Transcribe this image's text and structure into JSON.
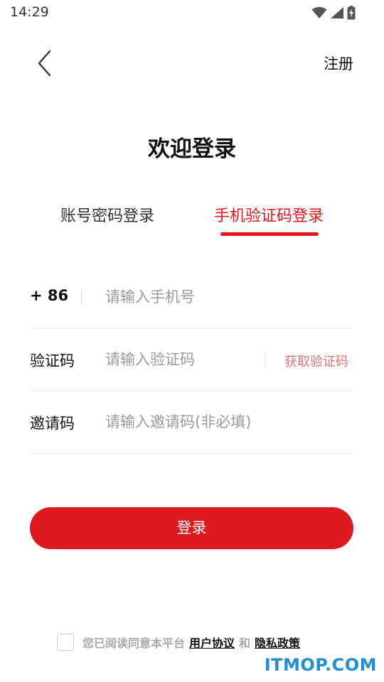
{
  "status_bar": {
    "time": "14:29",
    "icons": [
      "wifi-icon",
      "signal-icon",
      "battery-icon"
    ]
  },
  "header": {
    "back_icon": "chevron-left-icon",
    "register_label": "注册"
  },
  "page": {
    "title": "欢迎登录"
  },
  "tabs": {
    "items": [
      {
        "label": "账号密码登录",
        "active": false
      },
      {
        "label": "手机验证码登录",
        "active": true
      }
    ]
  },
  "form": {
    "phone": {
      "prefix": "+ 86",
      "placeholder": "请输入手机号",
      "value": ""
    },
    "code": {
      "label": "验证码",
      "placeholder": "请输入验证码",
      "value": "",
      "get_code_label": "获取验证码"
    },
    "invite": {
      "label": "邀请码",
      "placeholder": "请输入邀请码(非必填)",
      "value": ""
    }
  },
  "login_button": {
    "label": "登录"
  },
  "agreement": {
    "checked": false,
    "prefix": "您已阅读同意本平台",
    "user_agreement": "用户协议",
    "and": "和",
    "privacy_policy": "隐私政策"
  },
  "watermark": {
    "text": "ITMOP.COM"
  },
  "colors": {
    "accent": "#e0181e",
    "button": "#dd1a1f",
    "get_code": "#e57373",
    "placeholder": "#9a9a9a",
    "watermark": "#1f8fd6"
  }
}
